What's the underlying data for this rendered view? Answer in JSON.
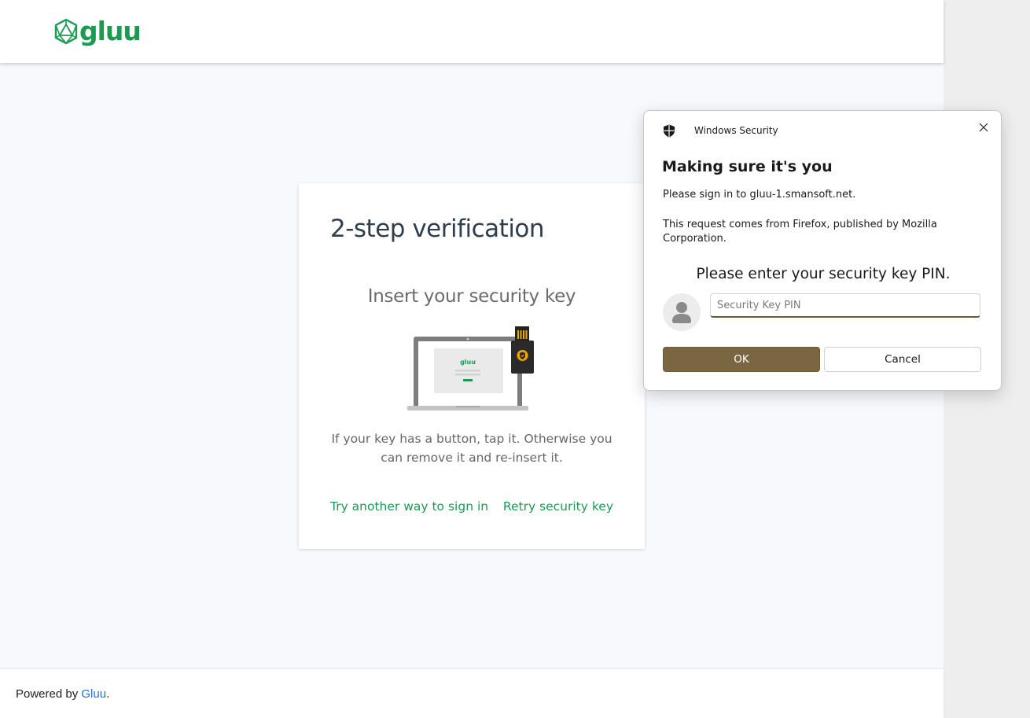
{
  "header": {
    "logo_text": "gluu"
  },
  "card": {
    "title": "2-step verification",
    "subtitle": "Insert your security key",
    "illustration_logo_text": "gluu",
    "body": "If your key has a button, tap it. Otherwise you can remove it and re-insert it.",
    "link_another_way": "Try another way to sign in",
    "link_retry": "Retry security key"
  },
  "footer": {
    "prefix": "Powered by",
    "link": "Gluu",
    "suffix": "."
  },
  "dialog": {
    "app_name": "Windows Security",
    "title": "Making sure it's you",
    "line1": "Please sign in to gluu-1.smansoft.net.",
    "line2": "This request comes from Firefox, published by Mozilla Corporation.",
    "prompt": "Please enter your security key PIN.",
    "pin_value": "",
    "pin_placeholder": "Security Key PIN",
    "ok_label": "OK",
    "cancel_label": "Cancel"
  },
  "colors": {
    "brand_green": "#1d9a52",
    "page_background": "#f8f9fc",
    "dialog_accent": "#7a6640",
    "footer_link": "#2a6fc9"
  },
  "icons": [
    "gluu-logo-icon",
    "laptop-illustration",
    "security-key-illustration",
    "shield-icon",
    "close-icon",
    "user-avatar-icon"
  ]
}
